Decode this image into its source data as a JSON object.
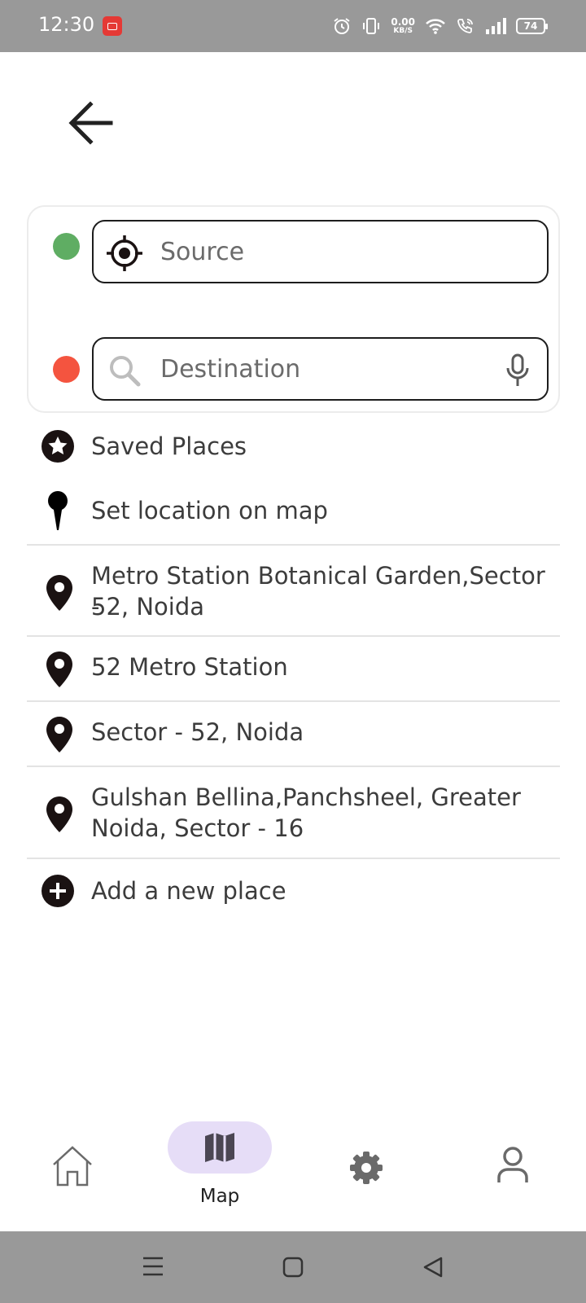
{
  "status_bar": {
    "time": "12:30",
    "net_speed_value": "0.00",
    "net_speed_unit": "KB/S",
    "battery": "74",
    "icons": [
      "screen-record-icon",
      "alarm-icon",
      "vibrate-icon",
      "wifi-icon",
      "wifi-call-icon",
      "signal-icon",
      "battery-icon"
    ]
  },
  "header": {
    "back_icon": "arrow-left-icon"
  },
  "route": {
    "source_placeholder": "Source",
    "destination_placeholder": "Destination",
    "source_dot_color": "#5fad63",
    "destination_dot_color": "#f4543f"
  },
  "list": {
    "saved_places": "Saved Places",
    "set_location": "Set location on map",
    "recent": [
      {
        "line1": "Metro Station Botanical Garden,Sector -",
        "line2": "52, Noida"
      },
      {
        "line1": "52 Metro Station",
        "line2": ""
      },
      {
        "line1": "Sector - 52, Noida",
        "line2": ""
      },
      {
        "line1": "Gulshan Bellina,Panchsheel, Greater",
        "line2": "Noida, Sector - 16"
      }
    ],
    "add_place": "Add a new place"
  },
  "bottom_nav": {
    "active_label": "Map",
    "active_color": "#e6ddf7",
    "items": [
      "home-icon",
      "map-icon",
      "settings-icon",
      "profile-icon"
    ]
  },
  "system_nav": {
    "items": [
      "menu-icon",
      "home-square-icon",
      "back-triangle-icon"
    ]
  }
}
